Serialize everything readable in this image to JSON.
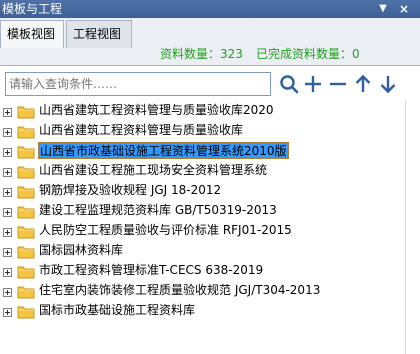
{
  "window": {
    "title": "模板与工程",
    "pin_glyph": "▼",
    "close_glyph": "×"
  },
  "tabs": [
    {
      "label": "模板视图"
    },
    {
      "label": "工程视图"
    }
  ],
  "stats": {
    "total": "资料数量：323",
    "done": "已完成资料数量：0"
  },
  "search": {
    "placeholder": "请输入查询条件……"
  },
  "toolbar": [
    "search-icon",
    "plus-icon",
    "minus-icon",
    "arrow-up-icon",
    "arrow-down-icon"
  ],
  "colors": {
    "titlebar": "#3d5f95",
    "stats": "#20a020",
    "selection": "#3399ff",
    "folder": "#f5c542",
    "toolbar_icon": "#2f5f9f"
  },
  "tree": {
    "selected_index": 2,
    "items": [
      {
        "label": "山西省建筑工程资料管理与质量验收库2020"
      },
      {
        "label": "山西省建筑工程资料管理与质量验收库"
      },
      {
        "label": "山西省市政基础设施工程资料管理系统2010版"
      },
      {
        "label": "山西省建设工程施工现场安全资料管理系统"
      },
      {
        "label": "钢筋焊接及验收规程 JGJ 18-2012"
      },
      {
        "label": "建设工程监理规范资料库 GB/T50319-2013"
      },
      {
        "label": "人民防空工程质量验收与评价标准 RFJ01-2015"
      },
      {
        "label": "国标园林资料库"
      },
      {
        "label": "市政工程资料管理标准T-CECS 638-2019"
      },
      {
        "label": "住宅室内装饰装修工程质量验收规范 JGJ/T304-2013"
      },
      {
        "label": "国标市政基础设施工程资料库"
      }
    ]
  }
}
